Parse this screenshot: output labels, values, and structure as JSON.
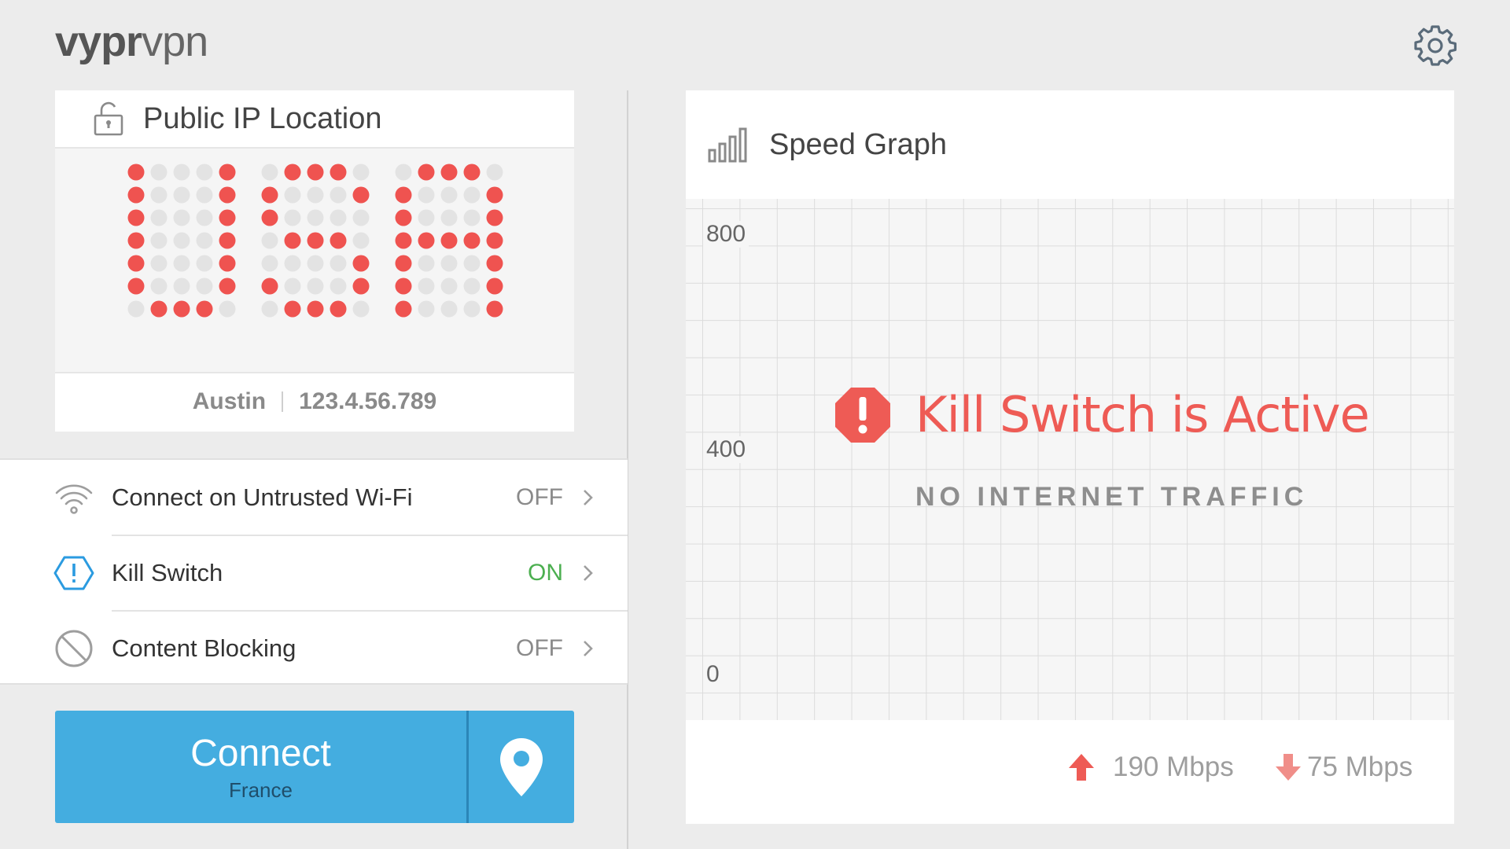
{
  "header": {
    "logo_bold": "vypr",
    "logo_light": "vpn",
    "settings_icon": "gear-icon"
  },
  "ip_card": {
    "title": "Public IP Location",
    "lock_icon": "unlocked-padlock-icon",
    "matrix_text": "USA",
    "city": "Austin",
    "ip": "123.4.56.789",
    "colors": {
      "on": "#ef5350",
      "off": "#e3e3e3"
    }
  },
  "settings": [
    {
      "label": "Connect on Untrusted Wi-Fi",
      "state": "OFF",
      "icon": "wifi-icon"
    },
    {
      "label": "Kill Switch",
      "state": "ON",
      "icon": "kill-switch-hexagon-icon"
    },
    {
      "label": "Content Blocking",
      "state": "OFF",
      "icon": "block-icon"
    }
  ],
  "connect": {
    "label": "Connect",
    "location": "France",
    "pin_icon": "location-pin-icon",
    "color": "#44ade0"
  },
  "speed_graph": {
    "title": "Speed Graph",
    "icon": "signal-bars-icon",
    "y_ticks": [
      "800",
      "400",
      "0"
    ],
    "alert_title": "Kill Switch is Active",
    "alert_subtitle": "NO INTERNET TRAFFIC",
    "alert_color": "#ee5b55",
    "upload": "190 Mbps",
    "download": "75 Mbps"
  }
}
